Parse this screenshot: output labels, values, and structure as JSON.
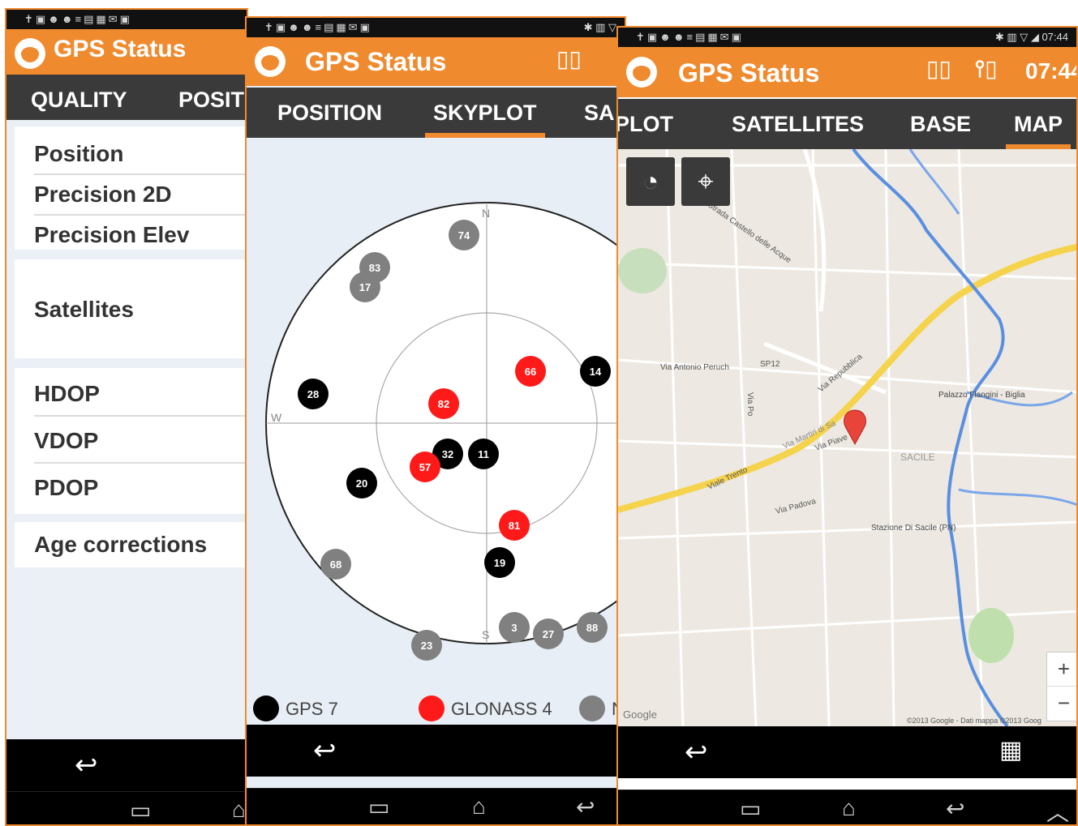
{
  "app": {
    "title": "GPS Status"
  },
  "screen1": {
    "tabs": [
      "QUALITY",
      "POSIT"
    ],
    "rows": [
      "Position",
      "Precision 2D",
      "Precision Elev",
      "Satellites",
      "HDOP",
      "VDOP",
      "PDOP",
      "Age corrections"
    ]
  },
  "screen2": {
    "tabs": [
      "POSITION",
      "SKYPLOT",
      "SA"
    ],
    "compass": {
      "n": "N",
      "s": "S",
      "w": "W"
    },
    "satellites": [
      {
        "id": "74",
        "system": "other"
      },
      {
        "id": "83",
        "system": "other"
      },
      {
        "id": "17",
        "system": "other"
      },
      {
        "id": "28",
        "system": "gps"
      },
      {
        "id": "66",
        "system": "glonass"
      },
      {
        "id": "14",
        "system": "gps"
      },
      {
        "id": "82",
        "system": "glonass"
      },
      {
        "id": "32",
        "system": "gps"
      },
      {
        "id": "11",
        "system": "gps"
      },
      {
        "id": "57",
        "system": "glonass"
      },
      {
        "id": "20",
        "system": "gps"
      },
      {
        "id": "81",
        "system": "glonass"
      },
      {
        "id": "19",
        "system": "gps"
      },
      {
        "id": "68",
        "system": "other"
      },
      {
        "id": "3",
        "system": "other"
      },
      {
        "id": "27",
        "system": "other"
      },
      {
        "id": "88",
        "system": "other"
      },
      {
        "id": "23",
        "system": "other"
      }
    ],
    "legend": [
      {
        "label": "GPS 7",
        "color": "#000000"
      },
      {
        "label": "GLONASS 4",
        "color": "#ff1a1a"
      },
      {
        "label": "N",
        "color": "#808080"
      }
    ]
  },
  "screen3": {
    "time": "07:44",
    "header_time": "07:44",
    "tabs": [
      "PLOT",
      "SATELLITES",
      "BASE",
      "MAP"
    ],
    "map_labels": {
      "via_antonio": "Via Antonio Peruch",
      "sp12": "SP12",
      "via_repubblica": "Via Repubblica",
      "viale_trento": "Viale Trento",
      "via_pordenone": "Via Padova",
      "via_martiri": "Via Martiri di Sa",
      "via_piave": "Via Piave",
      "sacile": "SACILE",
      "palazzo": "Palazzo Flangini - Biglia",
      "stazione": "Stazione Di Sacile (PN)",
      "strada_castello": "Strada Castello delle Acque",
      "via_po": "Via Po",
      "copyright": "©2013 Google - Dati mappa ©2013 Goog",
      "google": "Google"
    },
    "zoom": {
      "plus": "+",
      "minus": "−"
    }
  }
}
